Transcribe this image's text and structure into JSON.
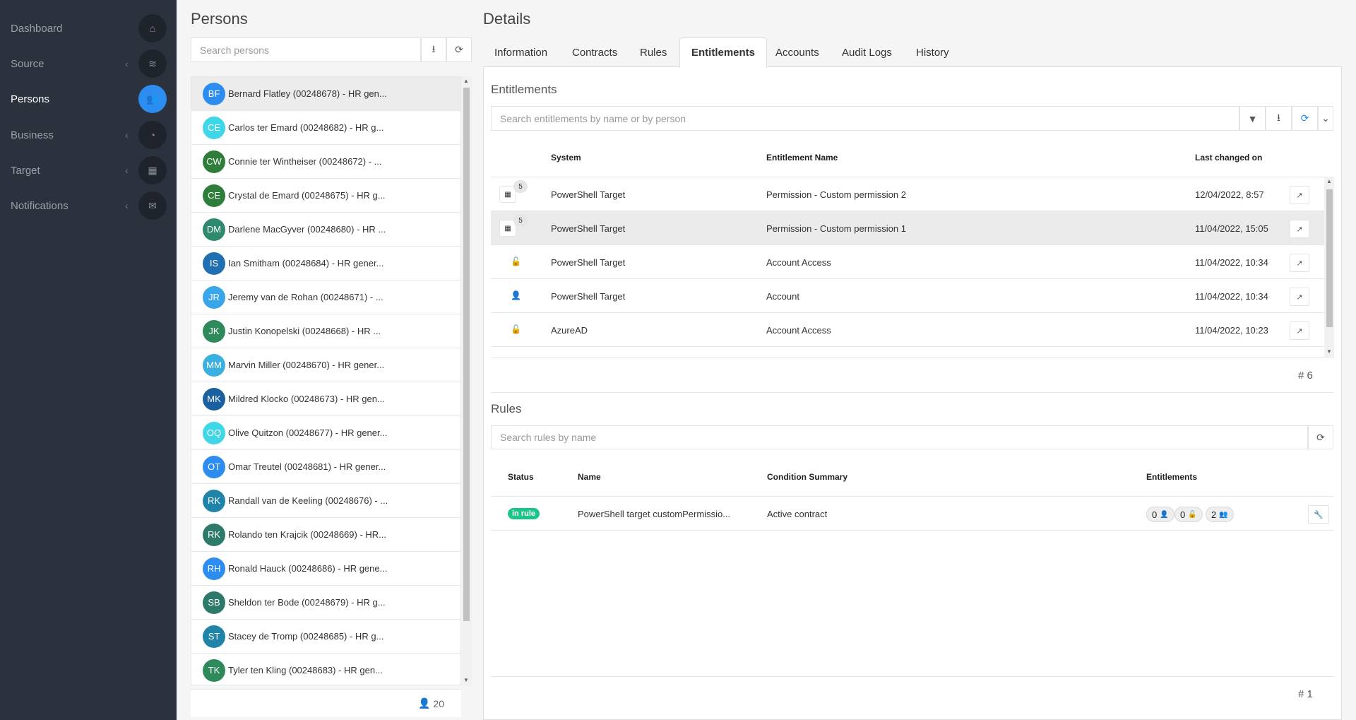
{
  "sidebar": {
    "items": [
      {
        "label": "Dashboard",
        "icon": "home-icon",
        "glyph": "⌂",
        "chevron": ""
      },
      {
        "label": "Source",
        "icon": "layers-icon",
        "glyph": "≋",
        "chevron": "‹"
      },
      {
        "label": "Persons",
        "icon": "users-icon",
        "glyph": "👥",
        "chevron": ""
      },
      {
        "label": "Business",
        "icon": "pie-chart-icon",
        "glyph": "◔",
        "chevron": "‹"
      },
      {
        "label": "Target",
        "icon": "grid-icon",
        "glyph": "▦",
        "chevron": "‹"
      },
      {
        "label": "Notifications",
        "icon": "envelope-icon",
        "glyph": "✉",
        "chevron": "‹"
      }
    ]
  },
  "persons": {
    "title": "Persons",
    "search_placeholder": "Search persons",
    "download_glyph": "⭳",
    "refresh_glyph": "⟳",
    "count": "20",
    "items": [
      {
        "initials": "BF",
        "name": "Bernard Flatley (00248678) - HR gen...",
        "color": "#2d8cf0"
      },
      {
        "initials": "CE",
        "name": "Carlos ter Emard (00248682) - HR g...",
        "color": "#3fd6e8"
      },
      {
        "initials": "CW",
        "name": "Connie ter Wintheiser (00248672) - ...",
        "color": "#2e7d3a"
      },
      {
        "initials": "CE",
        "name": "Crystal de Emard (00248675) - HR g...",
        "color": "#2e7d3a"
      },
      {
        "initials": "DM",
        "name": "Darlene MacGyver (00248680) - HR ...",
        "color": "#2e8a6e"
      },
      {
        "initials": "IS",
        "name": "Ian Smitham (00248684) - HR gener...",
        "color": "#1f6fb2"
      },
      {
        "initials": "JR",
        "name": "Jeremy van de Rohan (00248671) - ...",
        "color": "#3aa6ea"
      },
      {
        "initials": "JK",
        "name": "Justin Konopelski (00248668) - HR ...",
        "color": "#2e8a5a"
      },
      {
        "initials": "MM",
        "name": "Marvin Miller (00248670) - HR gener...",
        "color": "#3ab0e0"
      },
      {
        "initials": "MK",
        "name": "Mildred Klocko (00248673) - HR gen...",
        "color": "#1a5fa0"
      },
      {
        "initials": "OQ",
        "name": "Olive Quitzon (00248677) - HR gener...",
        "color": "#3fd6e8"
      },
      {
        "initials": "OT",
        "name": "Omar Treutel (00248681) - HR gener...",
        "color": "#2d8cf0"
      },
      {
        "initials": "RK",
        "name": "Randall van de Keeling (00248676) - ...",
        "color": "#1f84a8"
      },
      {
        "initials": "RK",
        "name": "Rolando ten Krajcik (00248669) - HR...",
        "color": "#2e7a6a"
      },
      {
        "initials": "RH",
        "name": "Ronald Hauck (00248686) - HR gene...",
        "color": "#2d8cf0"
      },
      {
        "initials": "SB",
        "name": "Sheldon ter Bode (00248679) - HR g...",
        "color": "#2e7a6a"
      },
      {
        "initials": "ST",
        "name": "Stacey de Tromp (00248685) - HR g...",
        "color": "#1f84a8"
      },
      {
        "initials": "TK",
        "name": "Tyler ten Kling (00248683) - HR gen...",
        "color": "#2e8a5a"
      }
    ]
  },
  "details": {
    "title": "Details",
    "tabs": [
      "Information",
      "Contracts",
      "Rules",
      "Entitlements",
      "Accounts",
      "Audit Logs",
      "History"
    ],
    "active_tab": "Entitlements"
  },
  "entitlements": {
    "title": "Entitlements",
    "search_placeholder": "Search entitlements by name or by person",
    "columns": {
      "system": "System",
      "name": "Entitlement Name",
      "changed": "Last changed on"
    },
    "rows": [
      {
        "icon": "grid-icon",
        "glyph": "▦",
        "badge": "5",
        "system": "PowerShell Target",
        "name": "Permission - Custom permission 2",
        "changed": "12/04/2022, 8:57"
      },
      {
        "icon": "grid-icon",
        "glyph": "▦",
        "badge": "5",
        "system": "PowerShell Target",
        "name": "Permission - Custom permission 1",
        "changed": "11/04/2022, 15:05"
      },
      {
        "icon": "unlock-icon",
        "glyph": "🔓",
        "badge": "",
        "system": "PowerShell Target",
        "name": "Account Access",
        "changed": "11/04/2022, 10:34"
      },
      {
        "icon": "user-icon",
        "glyph": "👤",
        "badge": "",
        "system": "PowerShell Target",
        "name": "Account",
        "changed": "11/04/2022, 10:34"
      },
      {
        "icon": "unlock-icon",
        "glyph": "🔓",
        "badge": "",
        "system": "AzureAD",
        "name": "Account Access",
        "changed": "11/04/2022, 10:23"
      }
    ],
    "count": "# 6"
  },
  "rules": {
    "title": "Rules",
    "search_placeholder": "Search rules by name",
    "columns": {
      "status": "Status",
      "name": "Name",
      "condition": "Condition Summary",
      "entitlements": "Entitlements"
    },
    "rows": [
      {
        "status": "in rule",
        "name": "PowerShell target customPermissio...",
        "condition": "Active contract",
        "accounts": "0",
        "access": "0",
        "permissions": "2"
      }
    ],
    "count": "# 1"
  }
}
